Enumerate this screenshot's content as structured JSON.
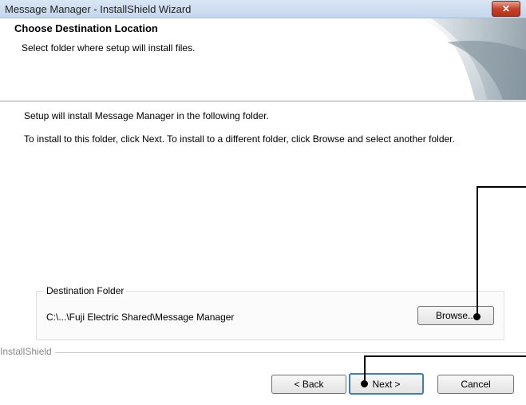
{
  "window": {
    "title": "Message Manager - InstallShield Wizard",
    "close_label": "✕"
  },
  "banner": {
    "title": "Choose Destination Location",
    "subtitle": "Select folder where setup will install files."
  },
  "body": {
    "line1": "Setup will install Message Manager in the following folder.",
    "line2": "To install to this folder, click Next. To install to a different folder, click Browse and select another folder."
  },
  "destination": {
    "legend": "Destination Folder",
    "path": "C:\\...\\Fuji Electric Shared\\Message Manager",
    "browse_label": "Browse..."
  },
  "footer": {
    "brand": "InstallShield",
    "back_label": "< Back",
    "next_label": "Next >",
    "cancel_label": "Cancel"
  }
}
